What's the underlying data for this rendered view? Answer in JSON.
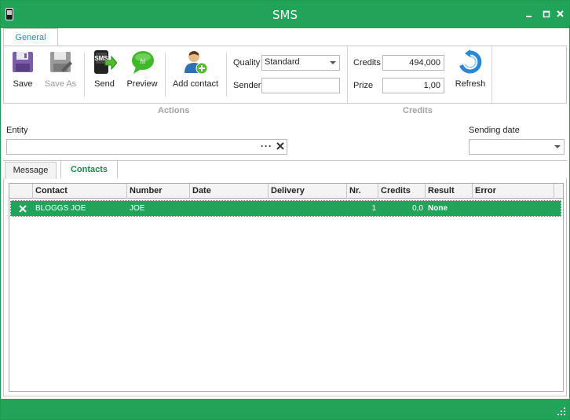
{
  "window": {
    "title": "SMS"
  },
  "ribbon": {
    "tab": "General",
    "buttons": {
      "save": "Save",
      "save_as": "Save As",
      "send": "Send",
      "preview": "Preview",
      "add_contact": "Add contact",
      "refresh": "Refresh"
    },
    "quality": {
      "label": "Quality",
      "value": "Standard"
    },
    "sender": {
      "label": "Sender",
      "value": ""
    },
    "credits": {
      "label": "Credits",
      "value": "494,000"
    },
    "prize": {
      "label": "Prize",
      "value": "1,00"
    },
    "groups": {
      "actions": "Actions",
      "credits": "Credits"
    },
    "icon_labels": {
      "send_icon_text": "SMS",
      "preview_icon_text": "hi"
    }
  },
  "form": {
    "entity": {
      "label": "Entity",
      "value": "",
      "browse": "···"
    },
    "sending_date": {
      "label": "Sending date",
      "value": ""
    }
  },
  "tabs": [
    {
      "label": "Message",
      "active": false
    },
    {
      "label": "Contacts",
      "active": true
    }
  ],
  "grid": {
    "columns": [
      "Contact",
      "Number",
      "Date",
      "Delivery",
      "Nr.",
      "Credits",
      "Result",
      "Error"
    ],
    "rows": [
      {
        "contact": "BLOGGS JOE",
        "number": "JOE",
        "date": "",
        "delivery": "",
        "nr": "1",
        "credits": "0,0",
        "result": "None",
        "error": ""
      }
    ]
  },
  "colors": {
    "accent": "#21a35a",
    "tab_text": "#1b8fbf",
    "group_label": "#a3a3a3"
  }
}
